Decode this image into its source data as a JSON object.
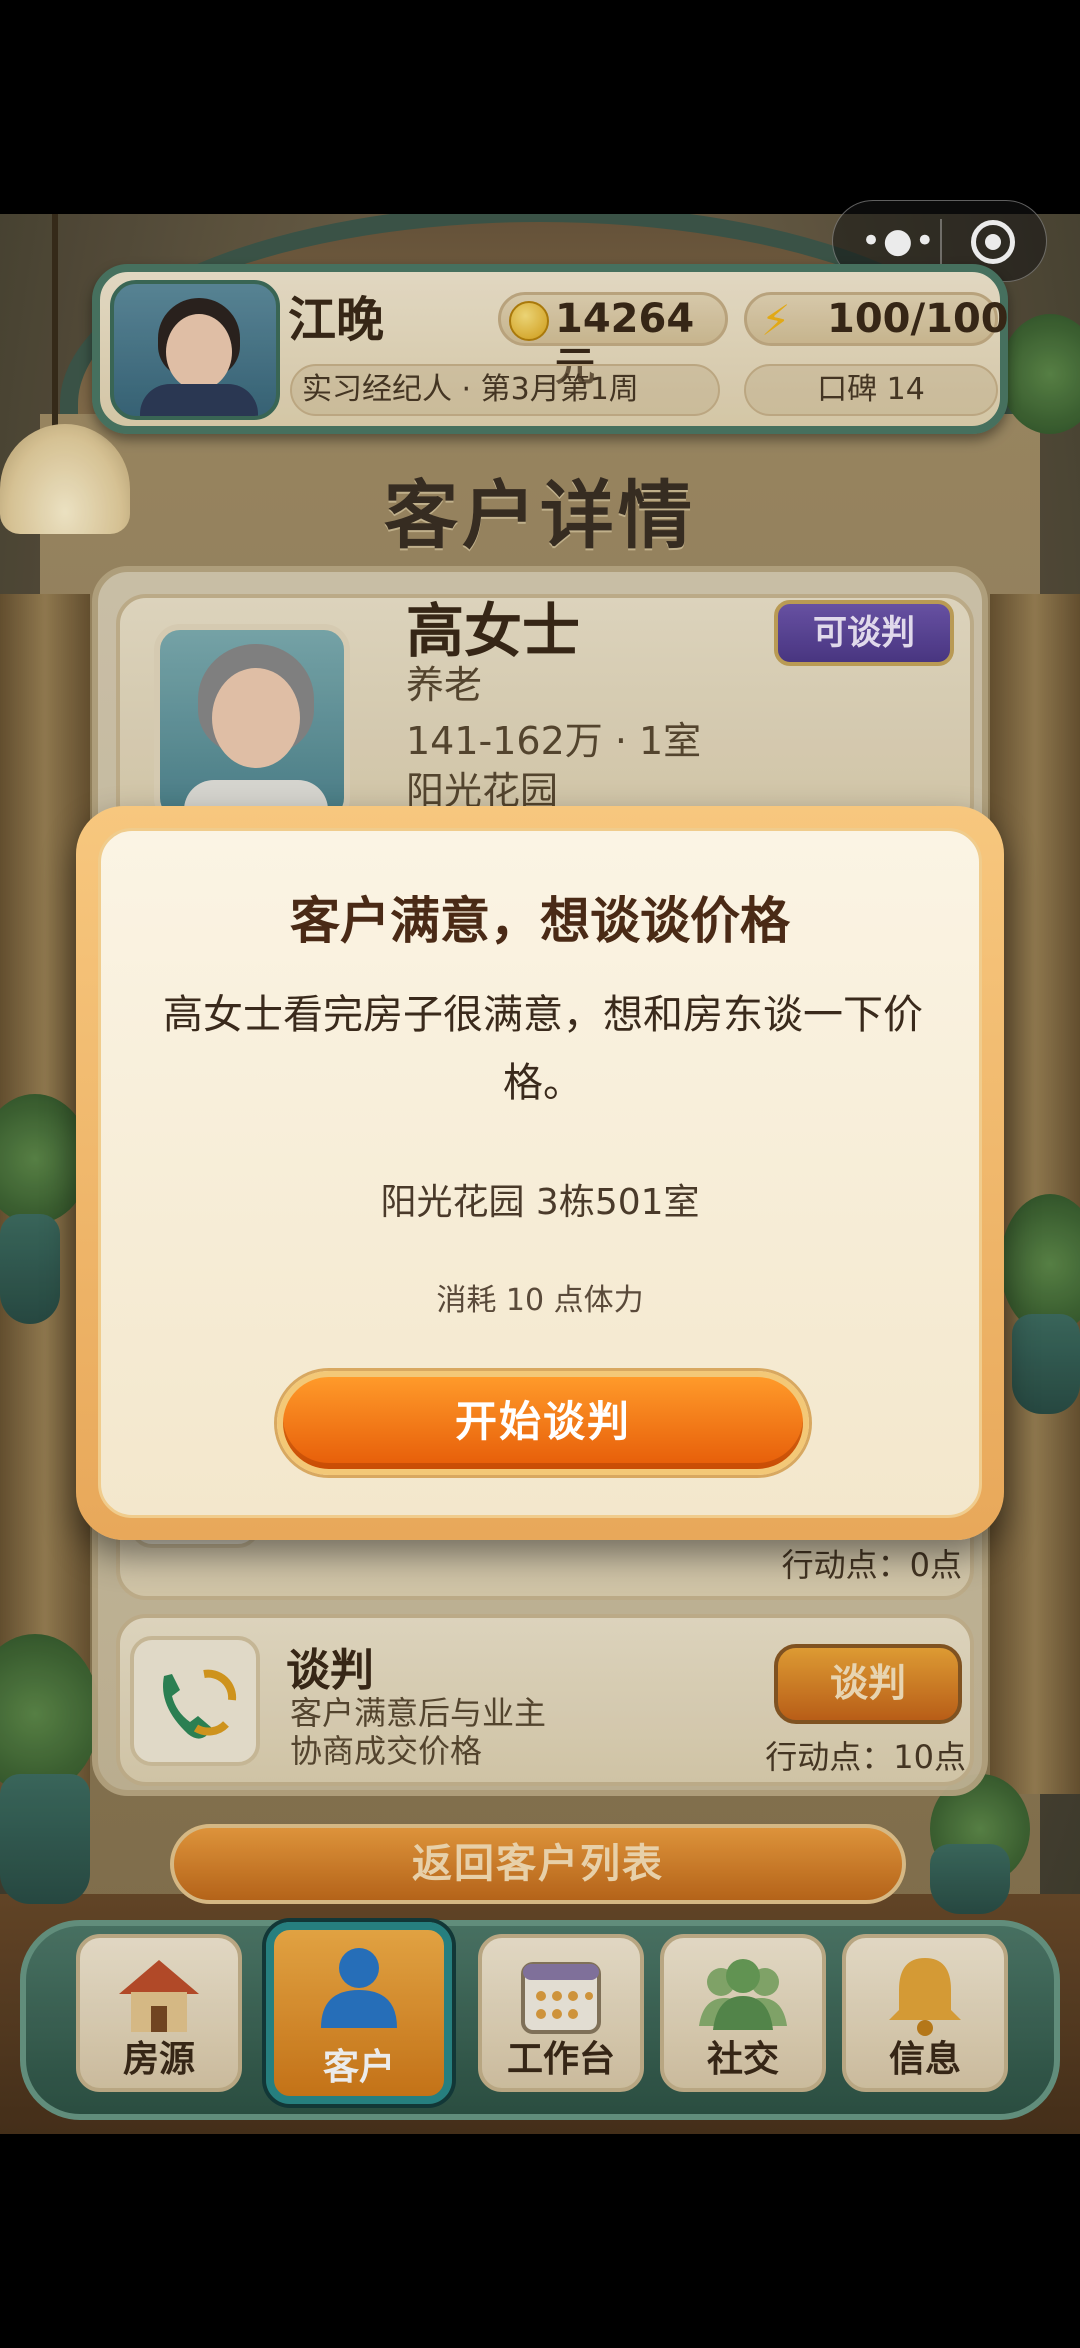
{
  "capsule": {
    "more_icon": "more-dots-icon",
    "close_icon": "target-circle-icon"
  },
  "player": {
    "name": "江晚",
    "coins": "14264元",
    "energy": "100/100",
    "rank_line": "实习经纪人 · 第3月第1周",
    "reputation": "口碑 14"
  },
  "page": {
    "title": "客户详情"
  },
  "client": {
    "name": "高女士",
    "purpose": "养老",
    "budget": "141-162万 · 1室",
    "area": "阳光花园",
    "status_badge": "可谈判"
  },
  "actions": [
    {
      "cost": "行动点：0点"
    },
    {
      "title": "谈判",
      "desc_line1": "客户满意后与业主",
      "desc_line2": "协商成交价格",
      "button": "谈判",
      "cost": "行动点：10点"
    }
  ],
  "back_button": "返回客户列表",
  "nav": [
    {
      "label": "房源",
      "icon": "house-icon"
    },
    {
      "label": "客户",
      "icon": "person-icon",
      "active": true
    },
    {
      "label": "工作台",
      "icon": "calendar-icon"
    },
    {
      "label": "社交",
      "icon": "group-icon"
    },
    {
      "label": "信息",
      "icon": "bell-icon"
    }
  ],
  "modal": {
    "title": "客户满意，想谈谈价格",
    "body": "高女士看完房子很满意，想和房东谈一下价格。",
    "address": "阳光花园 3栋501室",
    "cost": "消耗 10 点体力",
    "confirm": "开始谈判"
  },
  "colors": {
    "accent_orange": "#e65c08",
    "frame_teal": "#4d7a66",
    "badge_purple": "#4f3a8c"
  }
}
